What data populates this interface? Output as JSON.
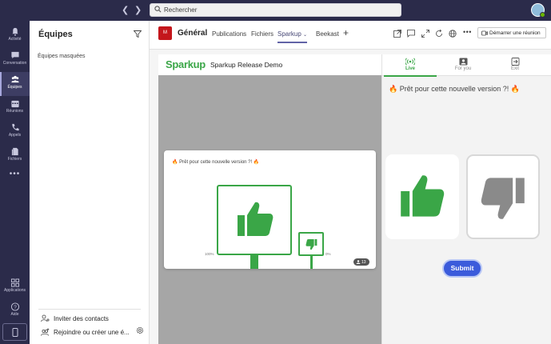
{
  "search": {
    "placeholder": "Rechercher"
  },
  "rail": {
    "items": [
      {
        "label": "Activité"
      },
      {
        "label": "Conversation"
      },
      {
        "label": "Équipes"
      },
      {
        "label": "Réunions"
      },
      {
        "label": "Appels"
      },
      {
        "label": "Fichiers"
      },
      {
        "label": "Applications"
      },
      {
        "label": "Aide"
      }
    ]
  },
  "panel": {
    "title": "Équipes",
    "hidden_teams": "Équipes masquées",
    "invite": "Inviter des contacts",
    "join": "Rejoindre ou créer une é..."
  },
  "header": {
    "team_initial": "M",
    "channel": "Général",
    "tabs": [
      "Publications",
      "Fichiers",
      "Sparkup",
      "Beekast"
    ],
    "meet_button": "Démarrer une réunion"
  },
  "app": {
    "logo": "Sparkup",
    "title": "Sparkup Release Demo"
  },
  "card": {
    "question": "🔥 Prêt pour cette nouvelle version ?! 🔥",
    "pct_up": "100%",
    "pct_down": "0%",
    "participants": "13"
  },
  "side": {
    "tabs": [
      "Live",
      "For you",
      "Exit"
    ],
    "question": "🔥 Prêt pour cette nouvelle version ?! 🔥",
    "submit": "Submit"
  },
  "colors": {
    "accent_green": "#3aa647",
    "teams_purple": "#6264a7",
    "submit_blue": "#3b5bdb",
    "thumb_down_grey": "#8a8a8a"
  }
}
